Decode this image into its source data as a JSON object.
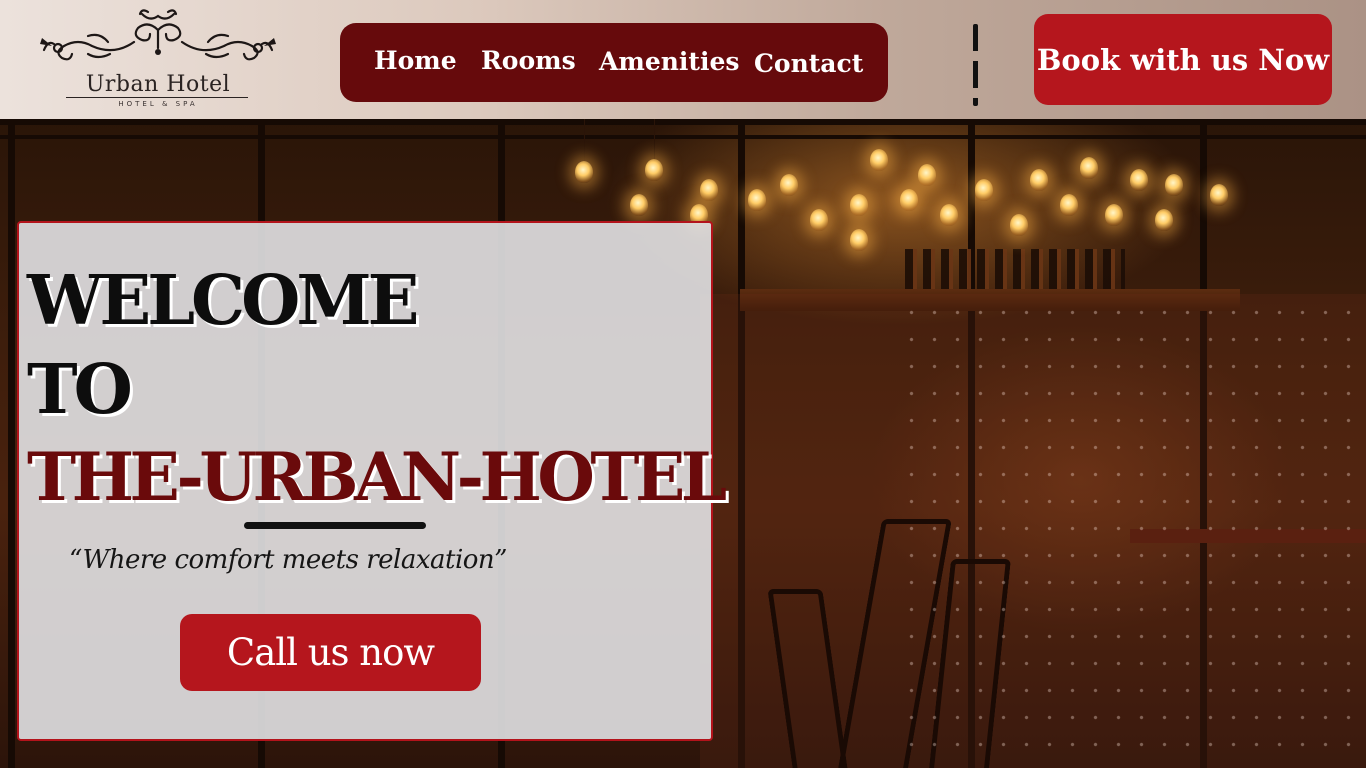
{
  "brand": {
    "name": "Urban Hotel",
    "subtitle": "HOTEL & SPA"
  },
  "nav": {
    "items": [
      {
        "label": "Home"
      },
      {
        "label": "Rooms"
      },
      {
        "label": "Amenities"
      },
      {
        "label": "Contact"
      }
    ]
  },
  "header": {
    "book_label": "Book with us Now"
  },
  "hero": {
    "welcome_line1": "WELCOME",
    "welcome_line2": "TO",
    "welcome_line3": "THE-URBAN-HOTEL",
    "tagline": "“Where comfort meets relaxation”",
    "call_label": "Call us now"
  },
  "colors": {
    "nav_background": "#660a0c",
    "accent_button": "#b5161d",
    "headline_accent": "#6a0a0b",
    "card_border": "#b3131b"
  },
  "icons": [
    "ornamental-flourish-icon",
    "divider-dashed-line"
  ]
}
